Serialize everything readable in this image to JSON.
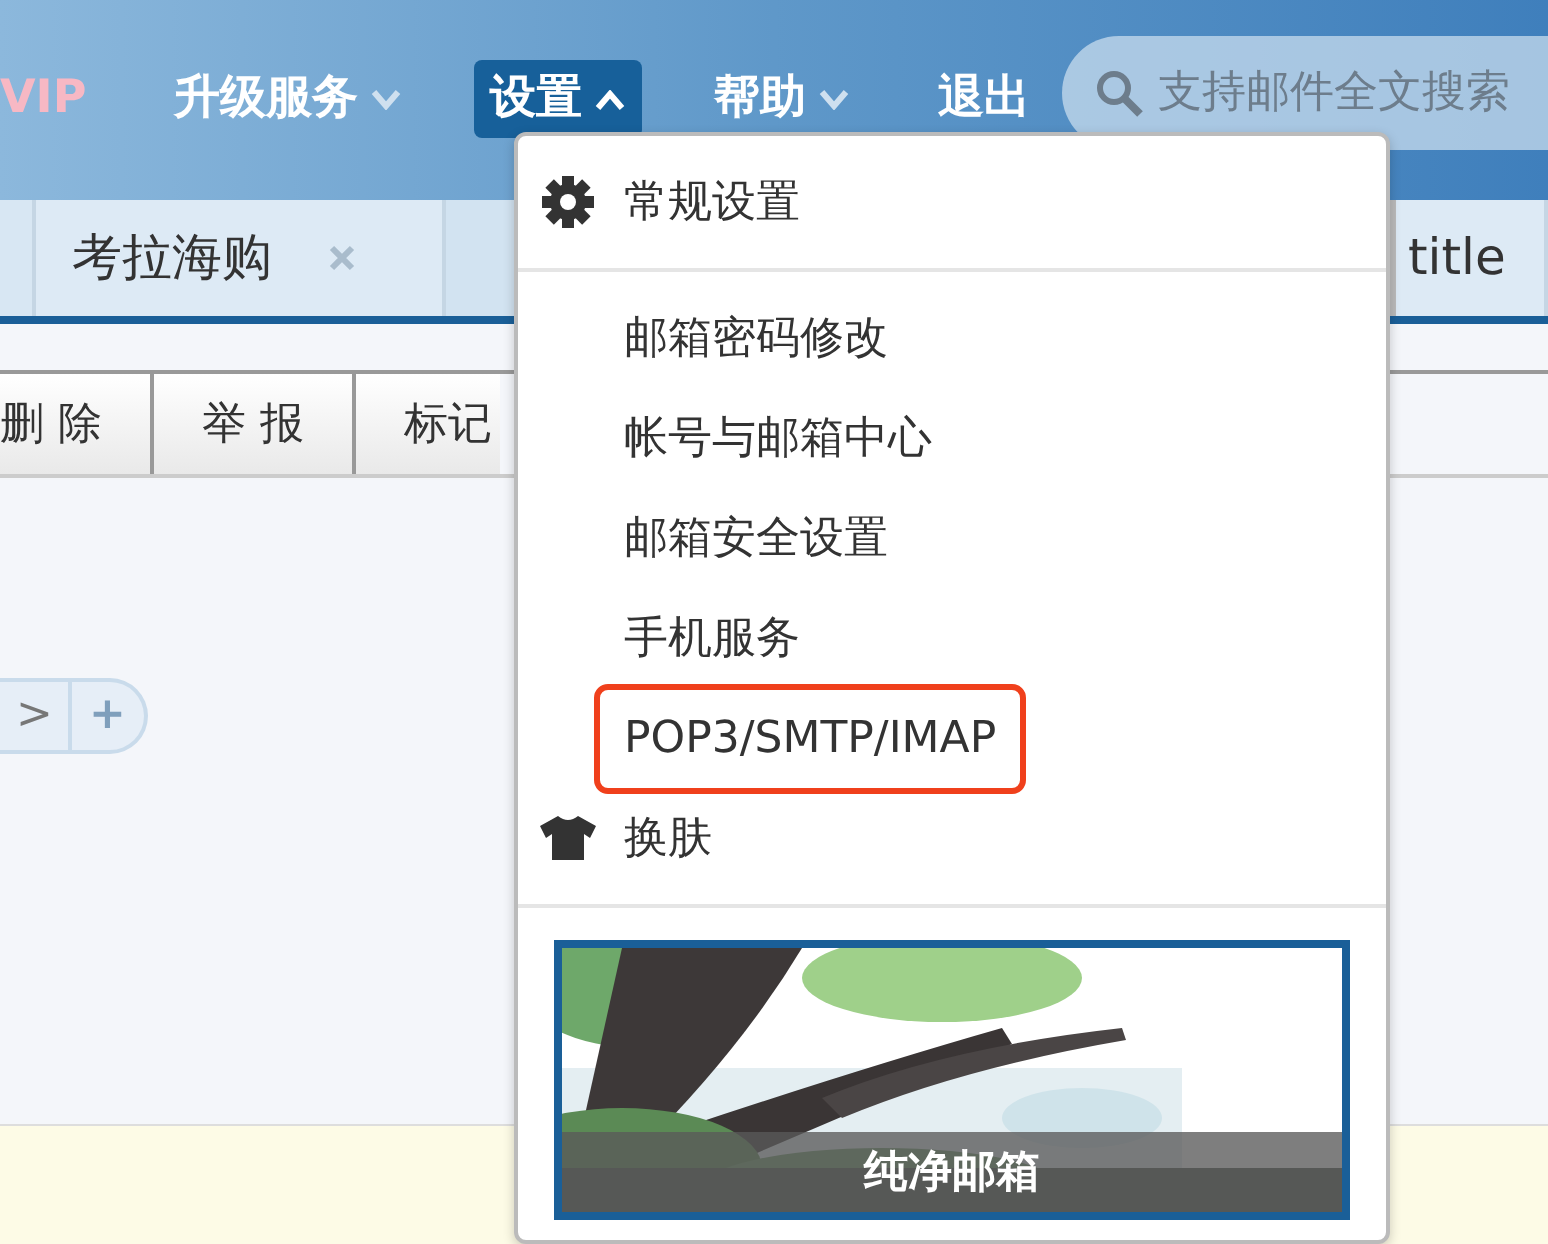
{
  "nav": {
    "items": [
      {
        "kind": "vip",
        "label": "VIP"
      },
      {
        "kind": "menu",
        "label": "升级服务",
        "expanded": false
      },
      {
        "kind": "menu",
        "label": "设置",
        "expanded": true
      },
      {
        "kind": "menu",
        "label": "帮助",
        "expanded": false
      },
      {
        "kind": "link",
        "label": "退出"
      }
    ],
    "search": {
      "placeholder": "支持邮件全文搜索"
    }
  },
  "tabs": [
    {
      "label": "考拉海购",
      "closable": true
    },
    {
      "label": "title"
    }
  ],
  "toolbar": {
    "buttons": [
      "删 除",
      "举 报",
      "标记"
    ]
  },
  "pager": {
    "buttons": [
      ">",
      "+"
    ]
  },
  "settings_menu": {
    "groups": [
      [
        {
          "kind": "settings",
          "label": "常规设置",
          "highlighted": false
        }
      ],
      [
        {
          "kind": "plain",
          "label": "邮箱密码修改",
          "highlighted": false
        },
        {
          "kind": "plain",
          "label": "帐号与邮箱中心",
          "highlighted": false
        },
        {
          "kind": "plain",
          "label": "邮箱安全设置",
          "highlighted": false
        },
        {
          "kind": "plain",
          "label": "手机服务",
          "highlighted": false
        },
        {
          "kind": "plain",
          "label": "POP3/SMTP/IMAP",
          "highlighted": true
        },
        {
          "kind": "skin",
          "label": "换肤",
          "highlighted": false
        }
      ]
    ],
    "skin_preview": {
      "kind": "picture",
      "caption": "纯净邮箱"
    }
  }
}
